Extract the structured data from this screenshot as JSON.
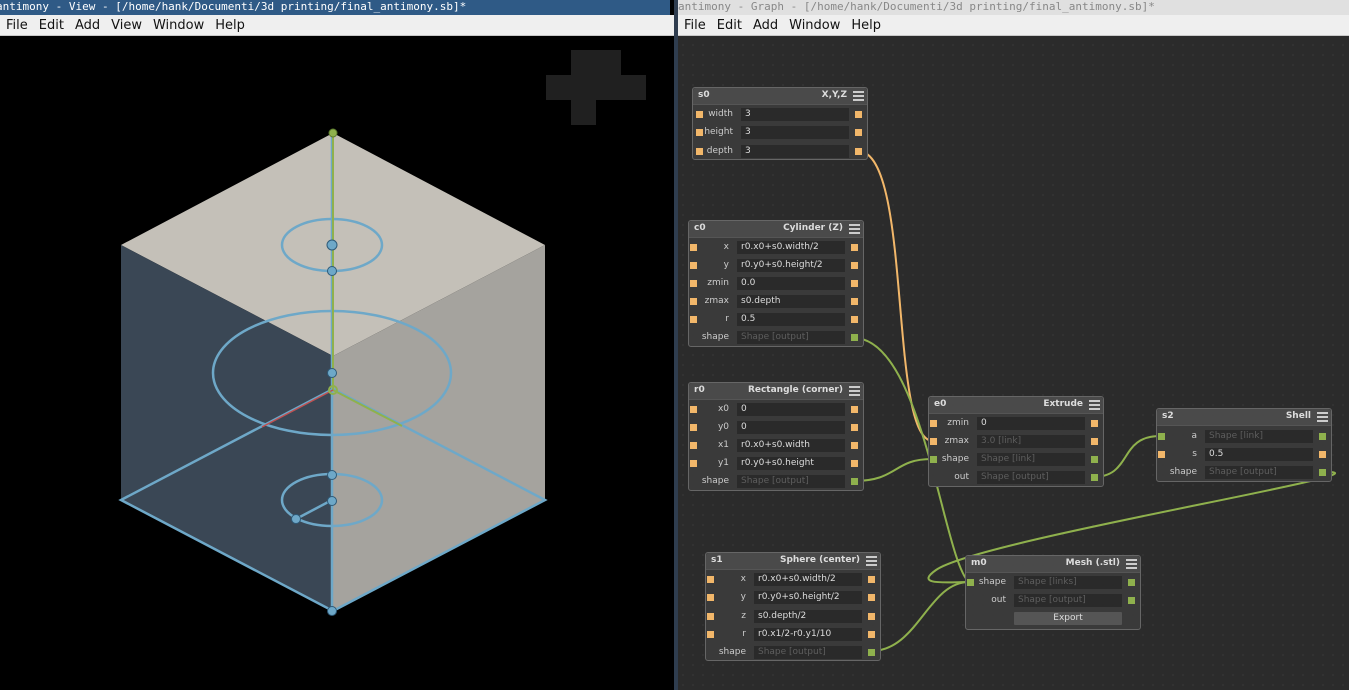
{
  "view_window": {
    "title": "antimony - View - [/home/hank/Documenti/3d printing/final_antimony.sb]*",
    "menu": [
      "File",
      "Edit",
      "Add",
      "View",
      "Window",
      "Help"
    ]
  },
  "graph_window": {
    "title": "antimony - Graph - [/home/hank/Documenti/3d printing/final_antimony.sb]*",
    "menu": [
      "File",
      "Edit",
      "Add",
      "Window",
      "Help"
    ]
  },
  "colors": {
    "node_bg": "#3a3a3a",
    "input_pin": "#f2b76a",
    "shape_pin": "#8fb14d",
    "shape_wire": "#8fb14d",
    "value_wire": "#f2b76a",
    "cube_top": "#c4c0b8",
    "cube_right": "#a5a39e",
    "cube_left": "#3a4755",
    "handle": "#6ea8c8"
  },
  "nodes": {
    "s0": {
      "id": "s0",
      "title": "X,Y,Z",
      "rows": [
        {
          "label": "width",
          "value": "3"
        },
        {
          "label": "height",
          "value": "3"
        },
        {
          "label": "depth",
          "value": "3"
        }
      ]
    },
    "c0": {
      "id": "c0",
      "title": "Cylinder (Z)",
      "rows": [
        {
          "label": "x",
          "value": "r0.x0+s0.width/2"
        },
        {
          "label": "y",
          "value": "r0.y0+s0.height/2"
        },
        {
          "label": "zmin",
          "value": "0.0"
        },
        {
          "label": "zmax",
          "value": "s0.depth"
        },
        {
          "label": "r",
          "value": "0.5"
        },
        {
          "label": "shape",
          "value": "Shape [output]"
        }
      ]
    },
    "r0": {
      "id": "r0",
      "title": "Rectangle (corner)",
      "rows": [
        {
          "label": "x0",
          "value": "0"
        },
        {
          "label": "y0",
          "value": "0"
        },
        {
          "label": "x1",
          "value": "r0.x0+s0.width"
        },
        {
          "label": "y1",
          "value": "r0.y0+s0.height"
        },
        {
          "label": "shape",
          "value": "Shape [output]"
        }
      ]
    },
    "e0": {
      "id": "e0",
      "title": "Extrude",
      "rows": [
        {
          "label": "zmin",
          "value": "0"
        },
        {
          "label": "zmax",
          "value": "3.0 [link]"
        },
        {
          "label": "shape",
          "value": "Shape [link]"
        },
        {
          "label": "out",
          "value": "Shape [output]"
        }
      ]
    },
    "s2": {
      "id": "s2",
      "title": "Shell",
      "rows": [
        {
          "label": "a",
          "value": "Shape [link]"
        },
        {
          "label": "s",
          "value": "0.5"
        },
        {
          "label": "shape",
          "value": "Shape [output]"
        }
      ]
    },
    "s1": {
      "id": "s1",
      "title": "Sphere (center)",
      "rows": [
        {
          "label": "x",
          "value": "r0.x0+s0.width/2"
        },
        {
          "label": "y",
          "value": "r0.y0+s0.height/2"
        },
        {
          "label": "z",
          "value": "s0.depth/2"
        },
        {
          "label": "r",
          "value": "r0.x1/2-r0.y1/10"
        },
        {
          "label": "shape",
          "value": "Shape [output]"
        }
      ]
    },
    "m0": {
      "id": "m0",
      "title": "Mesh (.stl)",
      "rows": [
        {
          "label": "shape",
          "value": "Shape [links]"
        },
        {
          "label": "out",
          "value": "Shape [output]"
        }
      ],
      "button": "Export"
    }
  }
}
